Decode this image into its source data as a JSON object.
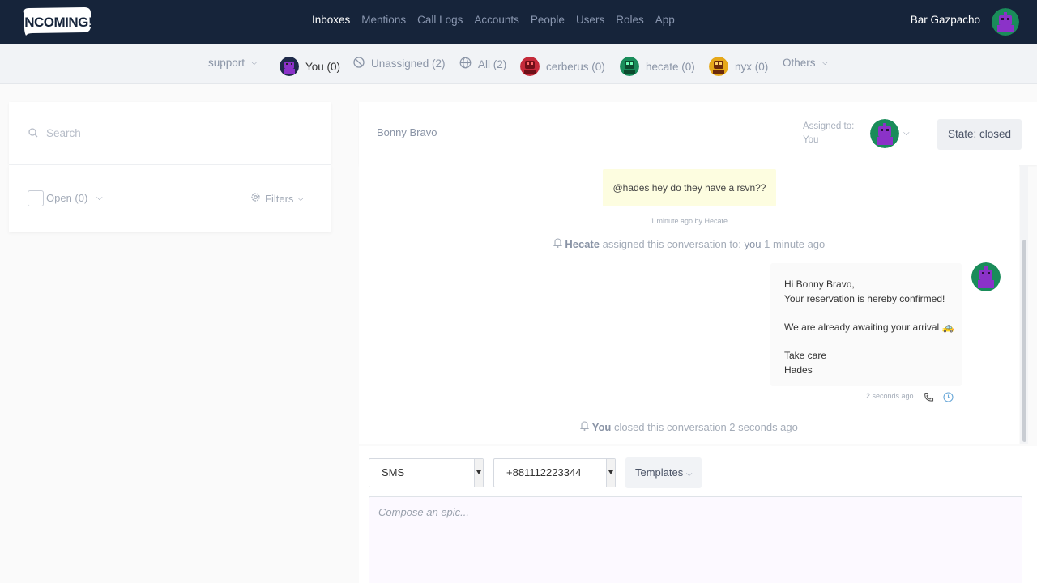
{
  "nav": {
    "logo_text": "INCOMING!",
    "links": [
      {
        "label": "Inboxes"
      },
      {
        "label": "Mentions"
      },
      {
        "label": "Call Logs"
      },
      {
        "label": "Accounts"
      },
      {
        "label": "People"
      },
      {
        "label": "Users"
      },
      {
        "label": "Roles"
      },
      {
        "label": "App"
      }
    ],
    "user_name": "Bar Gazpacho"
  },
  "filter_bar": {
    "inbox": "support",
    "you": "You (0)",
    "unassigned": "Unassigned (2)",
    "all": "All (2)",
    "cerberus": "cerberus (0)",
    "hecate": "hecate (0)",
    "nyx": "nyx (0)",
    "others": "Others"
  },
  "left_panel": {
    "search_placeholder": "Search",
    "status_filter": "Open (0)",
    "filters_label": "Filters"
  },
  "conversation": {
    "contact_name": "Bonny Bravo",
    "assigned_label_1": "Assigned to:",
    "assigned_label_2": "You",
    "state": "State: closed",
    "messages": {
      "note_text": "@hades hey do they have a rsvn??",
      "note_meta": "1 minute ago by Hecate",
      "event1_actor": "Hecate",
      "event1_text": "assigned this conversation to:",
      "event1_target": "you",
      "event1_time": "1 minute ago",
      "msg_lines": [
        "Hi Bonny Bravo,",
        "Your reservation is hereby confirmed!",
        "",
        "We are already awaiting your arrival 🚕",
        "",
        "Take care",
        "Hades"
      ],
      "msg_meta": "2 seconds ago",
      "event2_actor": "You",
      "event2_text": "closed this conversation 2 seconds ago"
    }
  },
  "composer": {
    "channel": "SMS",
    "phone": "+881112223344",
    "templates_label": "Templates",
    "placeholder": "Compose an epic..."
  },
  "colors": {
    "nav_bg": "#16243a",
    "avatar_purple": "#8b32c8",
    "avatar_green": "#1a8c5a",
    "avatar_red": "#c42a3a",
    "avatar_yellow": "#e6a81a"
  }
}
